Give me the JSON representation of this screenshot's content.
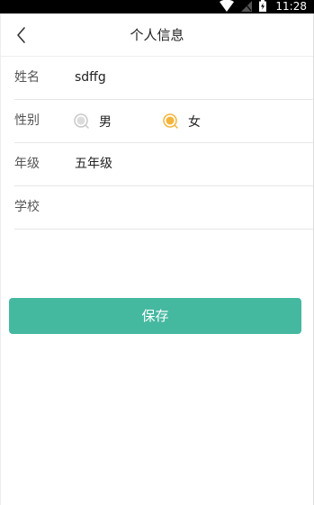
{
  "status_bar": {
    "time": "11:28",
    "icons": [
      "wifi-icon",
      "signal-icon",
      "battery-charging-icon"
    ]
  },
  "header": {
    "title": "个人信息",
    "back_icon": "chevron-left-icon"
  },
  "form": {
    "name": {
      "label": "姓名",
      "value": "sdffg"
    },
    "gender": {
      "label": "性别",
      "options": [
        {
          "label": "男",
          "selected": false
        },
        {
          "label": "女",
          "selected": true
        }
      ]
    },
    "grade": {
      "label": "年级",
      "value": "五年级"
    },
    "school": {
      "label": "学校",
      "value": ""
    }
  },
  "save_button": {
    "label": "保存"
  },
  "colors": {
    "accent": "#45b8a0",
    "radio_selected": "#f5b53a",
    "radio_unselected": "#c8c8c8"
  }
}
